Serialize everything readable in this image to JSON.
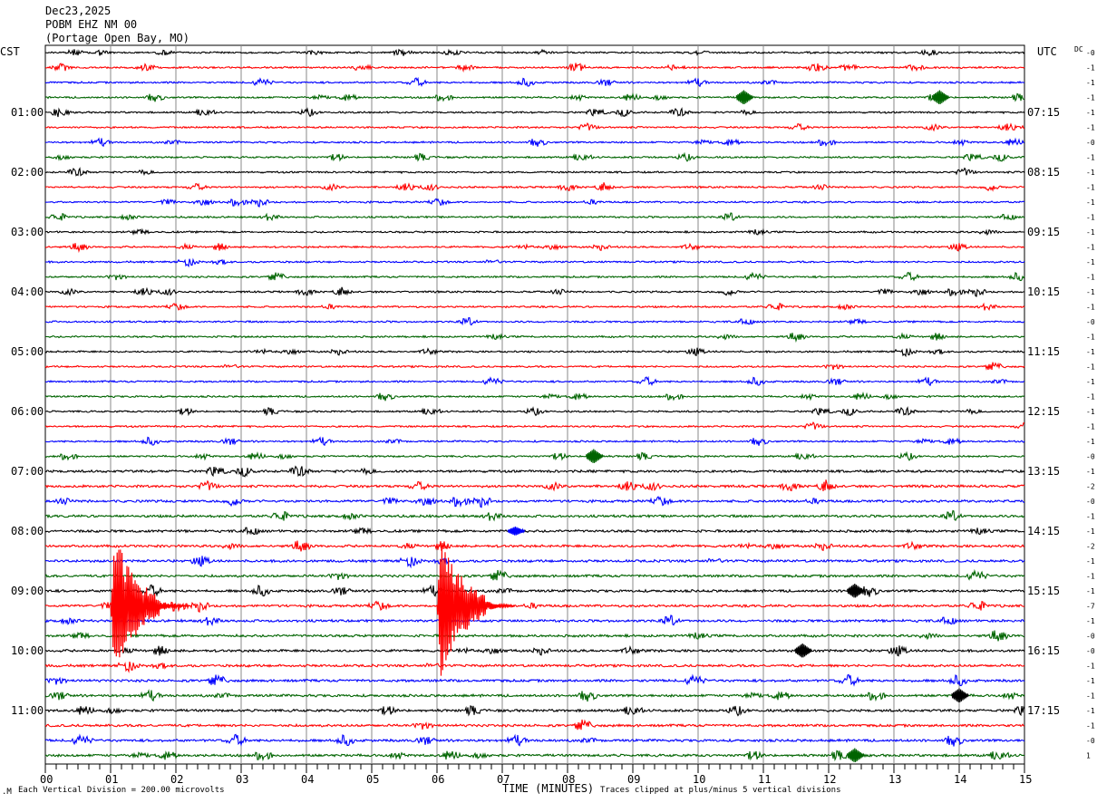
{
  "header": {
    "date": "Dec23,2025",
    "station": "POBM EHZ NM 00",
    "location": "(Portage Open Bay, MO)"
  },
  "left_timezone": "CST",
  "right_timezone": "UTC",
  "dc_header": "DC",
  "footer": {
    "scale_note": "Each Vertical Division =  200.00 microvolts",
    "xlabel": "TIME (MINUTES)",
    "clip_note": "Traces clipped at plus/minus 5 vertical divisions"
  },
  "colors": {
    "trace_cycle": [
      "#000000",
      "#ff0000",
      "#0000ff",
      "#006400"
    ],
    "grid": "#8a8a8a",
    "frame": "#000000"
  },
  "chart_data": {
    "type": "line",
    "title": "",
    "xlabel": "TIME (MINUTES)",
    "x_ticks": [
      "00",
      "01",
      "02",
      "03",
      "04",
      "05",
      "06",
      "07",
      "08",
      "09",
      "10",
      "11",
      "12",
      "13",
      "14",
      "15"
    ],
    "xlim": [
      0,
      15
    ],
    "rows_per_hour": 4,
    "row_count": 48,
    "left_hour_labels": [
      "01:00",
      "02:00",
      "03:00",
      "04:00",
      "05:00",
      "06:00",
      "07:00",
      "08:00",
      "09:00",
      "10:00",
      "11:00"
    ],
    "right_hour_labels": [
      "07:15",
      "08:15",
      "09:15",
      "10:15",
      "11:15",
      "12:15",
      "13:15",
      "14:15",
      "15:15",
      "16:15",
      "17:15"
    ],
    "dc_offsets": [
      "-0",
      "-1",
      "-1",
      "-1",
      "-1",
      "-1",
      "-0",
      "-1",
      "-1",
      "-1",
      "-1",
      "-1",
      "-1",
      "-1",
      "-1",
      "-1",
      "-1",
      "-1",
      "-0",
      "-1",
      "-1",
      "-1",
      "-1",
      "-1",
      "-1",
      "-1",
      "-1",
      "-0",
      "-1",
      "-2",
      "-0",
      "-1",
      "-1",
      "-2",
      "-1",
      "-1",
      "-1",
      "-7",
      "-1",
      "-0",
      "-0",
      "-1",
      "-1",
      "-1",
      "-1",
      "-1",
      "-0",
      "1"
    ],
    "events": [
      {
        "row": 37,
        "minute": 1.0,
        "amplitude": "clipped",
        "color": "red"
      },
      {
        "row": 37,
        "minute": 6.0,
        "amplitude": "clipped",
        "color": "red"
      },
      {
        "row": 3,
        "minute": 10.7,
        "amplitude": "moderate",
        "color": "green"
      },
      {
        "row": 3,
        "minute": 13.7,
        "amplitude": "moderate",
        "color": "green"
      },
      {
        "row": 27,
        "minute": 8.4,
        "amplitude": "moderate",
        "color": "green"
      },
      {
        "row": 36,
        "minute": 12.4,
        "amplitude": "moderate",
        "color": "black"
      },
      {
        "row": 40,
        "minute": 11.6,
        "amplitude": "moderate",
        "color": "black"
      },
      {
        "row": 47,
        "minute": 12.4,
        "amplitude": "moderate",
        "color": "green"
      },
      {
        "row": 43,
        "minute": 14.0,
        "amplitude": "moderate",
        "color": "black"
      },
      {
        "row": 32,
        "minute": 7.2,
        "amplitude": "small",
        "color": "blue"
      }
    ]
  }
}
